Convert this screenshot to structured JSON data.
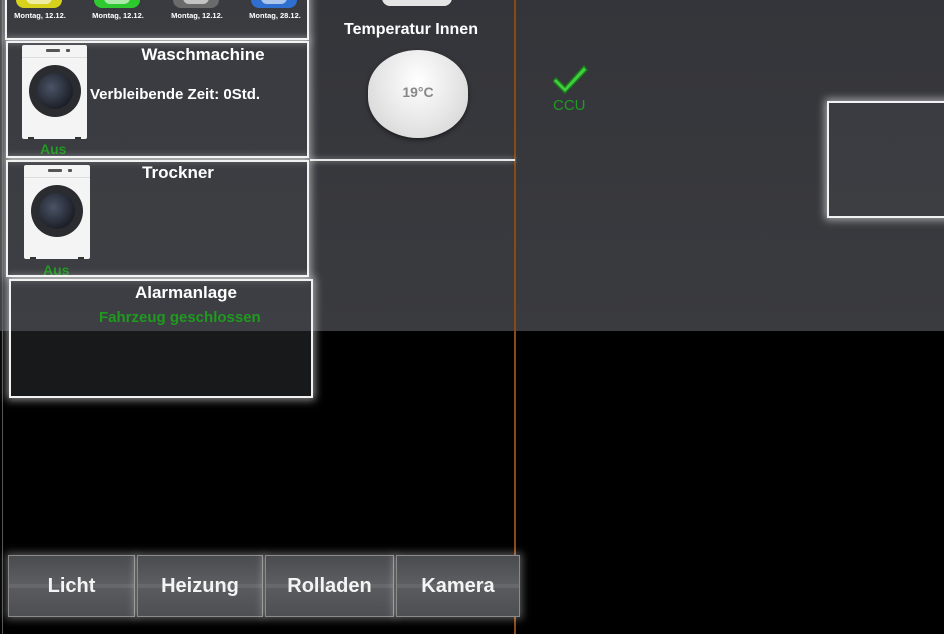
{
  "trash": [
    {
      "label": "Montag, 12.12.",
      "color": "#d6d21c"
    },
    {
      "label": "Montag, 12.12.",
      "color": "#2ec92e"
    },
    {
      "label": "Montag, 12.12.",
      "color": "#6a6a6a"
    },
    {
      "label": "Montag, 28.12.",
      "color": "#2f6fd0"
    }
  ],
  "washer": {
    "title": "Waschmachine",
    "remaining": "Verbleibende Zeit: 0Std.",
    "status": "Aus"
  },
  "dryer": {
    "title": "Trockner",
    "status": "Aus"
  },
  "alarm": {
    "title": "Alarmanlage",
    "status": "Fahrzeug geschlossen"
  },
  "temperature": {
    "title": "Temperatur Innen",
    "value": "19°C"
  },
  "ccu": {
    "label": "CCU",
    "icon": "check-icon",
    "color": "#1f9a1f"
  },
  "nav": {
    "licht": "Licht",
    "heizung": "Heizung",
    "rolladen": "Rolladen",
    "kamera": "Kamera"
  },
  "colors": {
    "accent_green": "#1f9a1f",
    "divider": "#8a4a16"
  }
}
